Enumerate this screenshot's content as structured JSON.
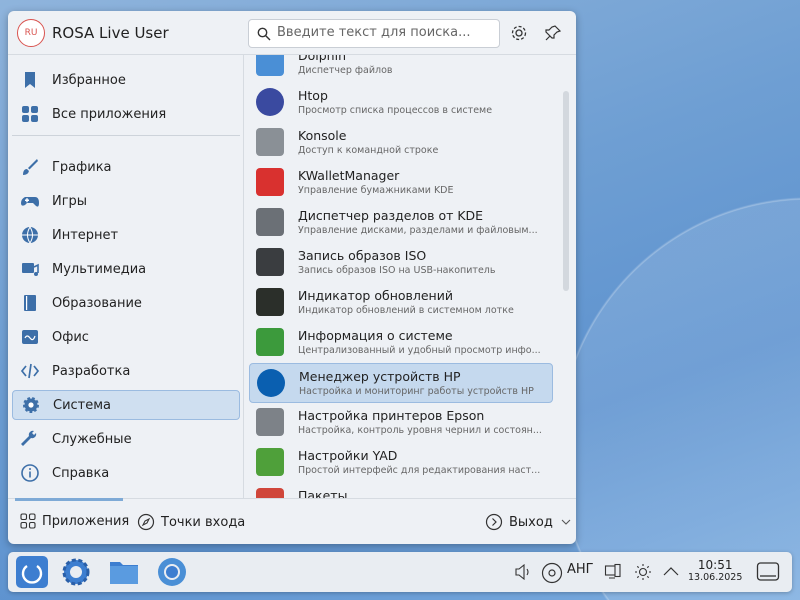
{
  "header": {
    "avatar_initials": "RU",
    "user_name": "ROSA Live User",
    "search_placeholder": "Введите текст для поиска..."
  },
  "sidebar": {
    "items": [
      {
        "label": "Избранное",
        "icon": "bookmark-icon"
      },
      {
        "label": "Все приложения",
        "icon": "grid-icon"
      },
      {
        "label": "Графика",
        "icon": "brush-icon"
      },
      {
        "label": "Игры",
        "icon": "gamepad-icon"
      },
      {
        "label": "Интернет",
        "icon": "globe-icon"
      },
      {
        "label": "Мультимедиа",
        "icon": "multimedia-icon"
      },
      {
        "label": "Образование",
        "icon": "book-icon"
      },
      {
        "label": "Офис",
        "icon": "office-icon"
      },
      {
        "label": "Разработка",
        "icon": "code-icon"
      },
      {
        "label": "Система",
        "icon": "gear-icon",
        "selected": true
      },
      {
        "label": "Служебные",
        "icon": "wrench-icon"
      },
      {
        "label": "Справка",
        "icon": "info-icon"
      }
    ]
  },
  "apps": [
    {
      "title": "Dolphin",
      "subtitle": "Диспетчер файлов",
      "color": "#4a8fd6"
    },
    {
      "title": "Htop",
      "subtitle": "Просмотр списка процессов в системе",
      "color": "#3a4aa0"
    },
    {
      "title": "Konsole",
      "subtitle": "Доступ к командной строке",
      "color": "#8a9096"
    },
    {
      "title": "KWalletManager",
      "subtitle": "Управление бумажниками KDE",
      "color": "#d9312f"
    },
    {
      "title": "Диспетчер разделов от KDE",
      "subtitle": "Управление дисками, разделами и файловым...",
      "color": "#6b7076"
    },
    {
      "title": "Запись образов ISO",
      "subtitle": "Запись образов ISO на USB-накопитель",
      "color": "#3a3d40"
    },
    {
      "title": "Индикатор обновлений",
      "subtitle": "Индикатор обновлений в системном лотке",
      "color": "#2b2f2a"
    },
    {
      "title": "Информация о системе",
      "subtitle": "Централизованный и удобный просмотр инфо...",
      "color": "#3c9a3c"
    },
    {
      "title": "Менеджер устройств HP",
      "subtitle": "Настройка и мониторинг работы устройств HP",
      "color": "#0a5fb0",
      "selected": true
    },
    {
      "title": "Настройка принтеров Epson",
      "subtitle": "Настройка, контроль уровня чернил и состоян...",
      "color": "#7d8288"
    },
    {
      "title": "Настройки YAD",
      "subtitle": "Простой интерфейс для редактирования наст...",
      "color": "#4fa03a"
    },
    {
      "title": "Пакеты",
      "subtitle": "",
      "color": "#d0463a"
    }
  ],
  "footer": {
    "applications": "Приложения",
    "places": "Точки входа",
    "leave": "Выход"
  },
  "taskbar": {
    "keyboard_layout": "АНГ",
    "time": "10:51",
    "date": "13.06.2025"
  }
}
